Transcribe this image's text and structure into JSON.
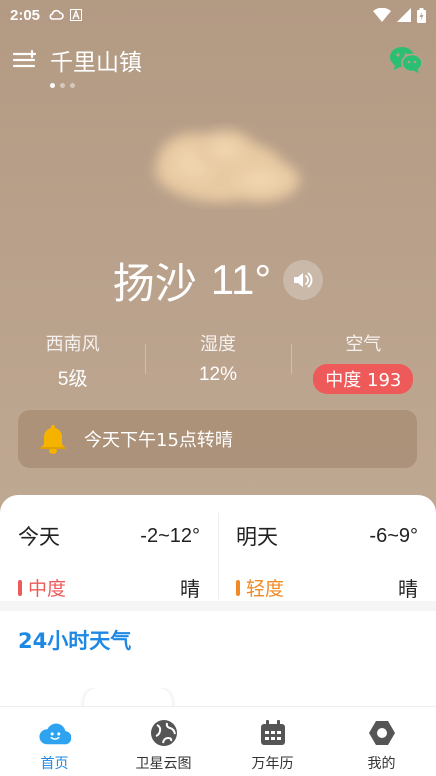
{
  "status_bar": {
    "time": "2:05"
  },
  "header": {
    "city": "千里山镇",
    "page_count": 3,
    "active_page": 0
  },
  "current": {
    "condition": "扬沙",
    "temperature": "11°"
  },
  "stats": [
    {
      "label": "西南风",
      "value": "5级"
    },
    {
      "label": "湿度",
      "value": "12%"
    },
    {
      "label": "空气",
      "value": "中度 193"
    }
  ],
  "alert": {
    "text": "今天下午15点转晴"
  },
  "days": [
    {
      "name": "今天",
      "range": "-2~12°",
      "aq": "中度",
      "aq_color": "#ee5a5a",
      "condition": "晴"
    },
    {
      "name": "明天",
      "range": "-6~9°",
      "aq": "轻度",
      "aq_color": "#f08a24",
      "condition": "晴"
    }
  ],
  "hourly": {
    "title": "24小时天气"
  },
  "tabs": [
    {
      "label": "首页",
      "icon": "home-cloud-icon",
      "active": true
    },
    {
      "label": "卫星云图",
      "icon": "globe-icon",
      "active": false
    },
    {
      "label": "万年历",
      "icon": "calendar-icon",
      "active": false
    },
    {
      "label": "我的",
      "icon": "profile-hexagon-icon",
      "active": false
    }
  ],
  "colors": {
    "accent": "#1e88e5",
    "aqi_moderate": "#ee5a5a",
    "aqi_light": "#f08a24",
    "wechat": "#2bbf73"
  }
}
